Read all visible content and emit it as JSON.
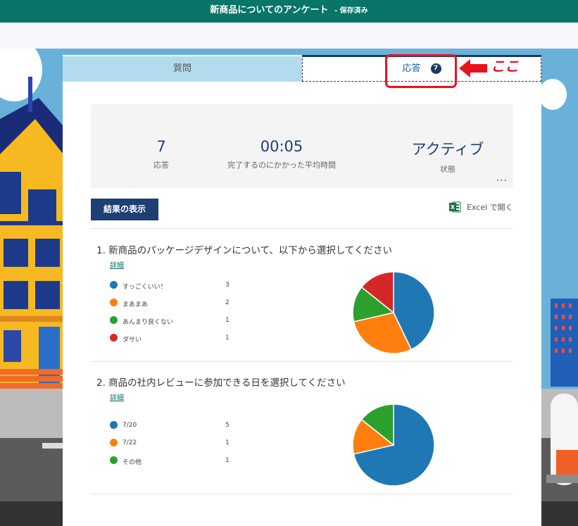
{
  "app": {
    "title": "新商品についてのアンケート",
    "saved_status": "- 保存済み"
  },
  "tabs": {
    "questions": "質問",
    "responses": "応答",
    "responses_count": "7"
  },
  "form_title": "新商品についてのアンケート",
  "stats": {
    "responses_value": "7",
    "responses_label": "応答",
    "avg_time_value": "00:05",
    "avg_time_label": "完了するのにかかった平均時間",
    "status_value": "アクティブ",
    "status_label": "状態",
    "more": "..."
  },
  "actions": {
    "view_results": "結果の表示",
    "open_excel": "Excel で開く"
  },
  "questions": [
    {
      "title": "1.  新商品のパッケージデザインについて、以下から選択してください",
      "detail": "詳細",
      "options": [
        {
          "label": "すっごくいい！",
          "count": "3",
          "value": 3,
          "color": "#1f77b4"
        },
        {
          "label": "まあまあ",
          "count": "2",
          "value": 2,
          "color": "#ff7f0e"
        },
        {
          "label": "あんまり良くない",
          "count": "1",
          "value": 1,
          "color": "#2ca02c"
        },
        {
          "label": "ダサい",
          "count": "1",
          "value": 1,
          "color": "#d62728"
        }
      ]
    },
    {
      "title": "2.  商品の社内レビューに参加できる日を選択してください",
      "detail": "詳細",
      "options": [
        {
          "label": "7/20",
          "count": "5",
          "value": 5,
          "color": "#1f77b4"
        },
        {
          "label": "7/22",
          "count": "1",
          "value": 1,
          "color": "#ff7f0e"
        },
        {
          "label": "その他",
          "count": "1",
          "value": 1,
          "color": "#2ca02c"
        }
      ]
    }
  ],
  "annotation": {
    "text": "ここ",
    "color": "#e8131b"
  }
}
